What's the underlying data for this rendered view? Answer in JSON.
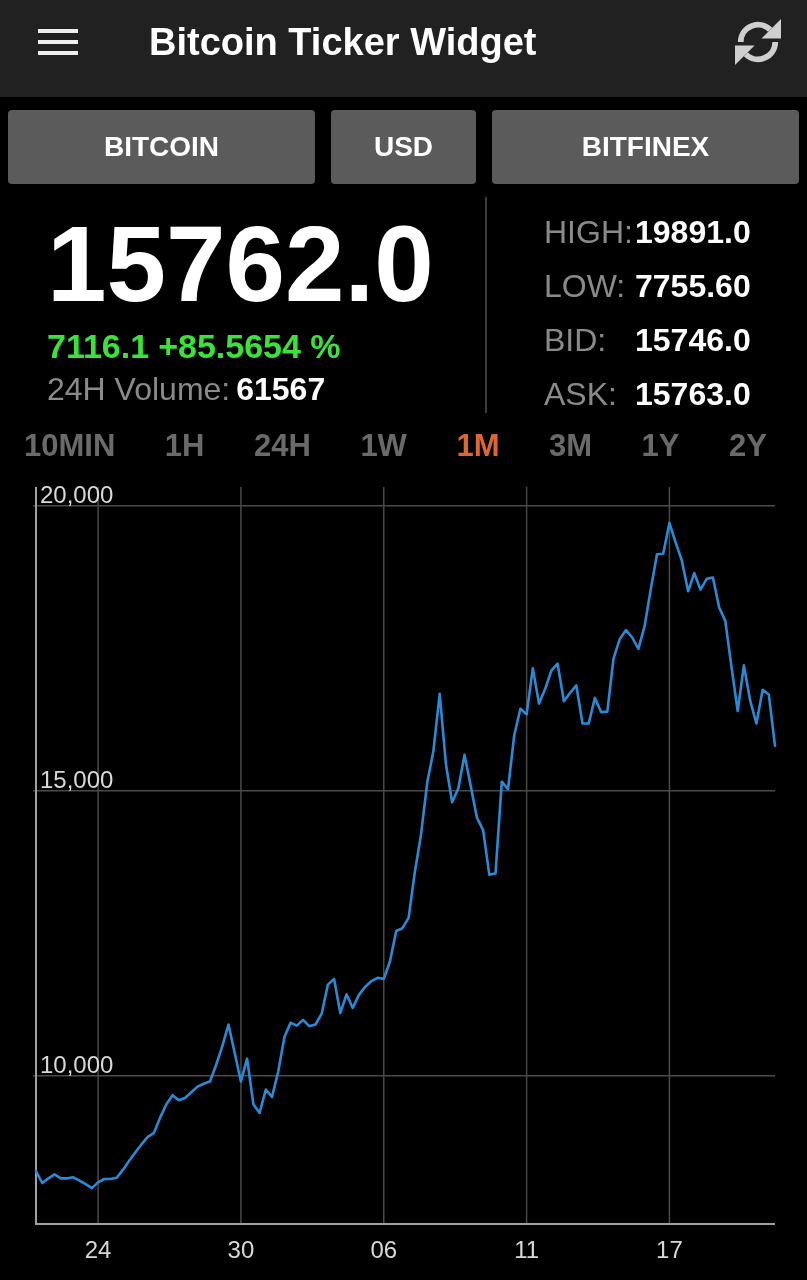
{
  "app_bar": {
    "title": "Bitcoin Ticker Widget"
  },
  "selectors": {
    "coin": "BITCOIN",
    "currency": "USD",
    "exchange": "BITFINEX"
  },
  "ticker": {
    "last": "15762.0",
    "change_amount": "7116.1",
    "change_percent": "+85.5654 %",
    "positive": true,
    "volume_label": "24H Volume:",
    "volume": "61567"
  },
  "stats": [
    {
      "label": "HIGH:",
      "value": "19891.0"
    },
    {
      "label": "LOW:",
      "value": "7755.60"
    },
    {
      "label": "BID:",
      "value": "15746.0"
    },
    {
      "label": "ASK:",
      "value": "15763.0"
    }
  ],
  "timeframes": [
    {
      "label": "10MIN",
      "selected": false
    },
    {
      "label": "1H",
      "selected": false
    },
    {
      "label": "24H",
      "selected": false
    },
    {
      "label": "1W",
      "selected": false
    },
    {
      "label": "1M",
      "selected": true
    },
    {
      "label": "3M",
      "selected": false
    },
    {
      "label": "1Y",
      "selected": false
    },
    {
      "label": "2Y",
      "selected": false
    }
  ],
  "chart": {
    "chart_data": {
      "type": "line",
      "grid": true,
      "categories": [
        null,
        null,
        null,
        null,
        null,
        null,
        null,
        null,
        null,
        null,
        "24",
        null,
        null,
        null,
        null,
        null,
        null,
        null,
        null,
        null,
        null,
        null,
        null,
        null,
        null,
        null,
        null,
        null,
        null,
        null,
        null,
        null,
        null,
        "30",
        null,
        null,
        null,
        null,
        null,
        null,
        null,
        null,
        null,
        null,
        null,
        null,
        null,
        null,
        null,
        null,
        null,
        null,
        null,
        null,
        null,
        null,
        "06",
        null,
        null,
        null,
        null,
        null,
        null,
        null,
        null,
        null,
        null,
        null,
        null,
        null,
        null,
        null,
        null,
        null,
        null,
        null,
        null,
        null,
        null,
        "11",
        null,
        null,
        null,
        null,
        null,
        null,
        null,
        null,
        null,
        null,
        null,
        null,
        null,
        null,
        null,
        null,
        null,
        null,
        null,
        null,
        null,
        null,
        "17",
        null,
        null,
        null,
        null,
        null,
        null,
        null,
        null,
        null,
        null,
        null,
        null,
        null,
        null,
        null,
        null,
        null
      ],
      "series": [
        {
          "color": "#2b8ad6",
          "values": [
            8330,
            8120,
            8200,
            8270,
            8200,
            8200,
            8220,
            8160,
            8100,
            8030,
            8130,
            8190,
            8190,
            8210,
            8350,
            8510,
            8660,
            8800,
            8930,
            9000,
            9270,
            9500,
            9660,
            9570,
            9610,
            9710,
            9810,
            9860,
            9900,
            10190,
            10520,
            10900,
            10400,
            9900,
            10300,
            9500,
            9350,
            9760,
            9630,
            10070,
            10680,
            10930,
            10880,
            10980,
            10870,
            10900,
            11090,
            11600,
            11700,
            11100,
            11430,
            11190,
            11420,
            11560,
            11660,
            11720,
            11700,
            12010,
            12540,
            12590,
            12770,
            13570,
            14230,
            15140,
            15700,
            16700,
            15470,
            14800,
            15040,
            15630,
            15090,
            14530,
            14310,
            13530,
            13550,
            15160,
            15030,
            15970,
            16440,
            16340,
            17150,
            16530,
            16790,
            17110,
            17230,
            16570,
            16720,
            16850,
            16180,
            16180,
            16630,
            16380,
            16390,
            17320,
            17660,
            17820,
            17690,
            17490,
            17890,
            18540,
            19150,
            19160,
            19700,
            19360,
            19040,
            18500,
            18820,
            18530,
            18720,
            18740,
            18220,
            17980,
            17170,
            16400,
            17200,
            16580,
            16180,
            16770,
            16690,
            15790
          ]
        }
      ],
      "ylim": [
        7400,
        20330
      ],
      "yticks": [
        {
          "value": 10000,
          "label": "10,000"
        },
        {
          "value": 15000,
          "label": "15,000"
        },
        {
          "value": 20000,
          "label": "20,000"
        }
      ]
    }
  }
}
